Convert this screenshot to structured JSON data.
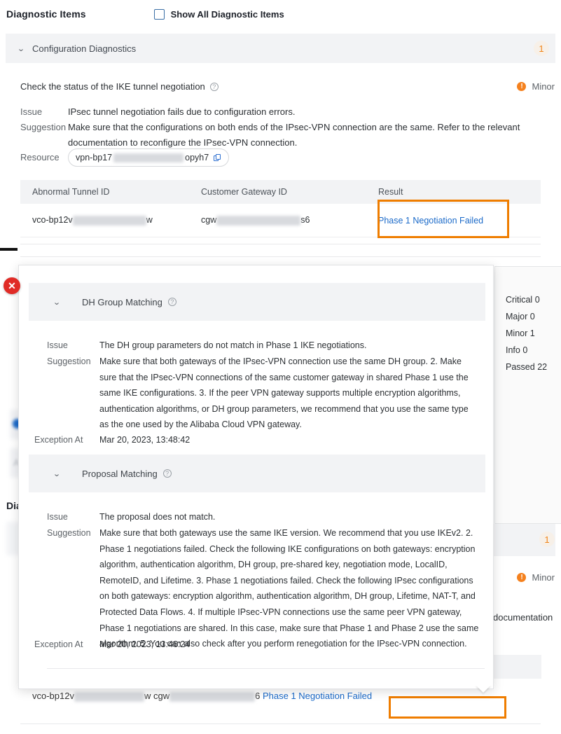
{
  "header": {
    "title": "Diagnostic Items",
    "checkbox_label": "Show All Diagnostic Items",
    "checkbox_checked": false
  },
  "group": {
    "label": "Configuration Diagnostics",
    "count": "1",
    "chevron": "chevron-down-icon"
  },
  "diagnostic": {
    "title": "Check the status of the IKE tunnel negotiation",
    "severity": "Minor",
    "severity_color": "#f5811e",
    "issue_key": "Issue",
    "issue": "IPsec tunnel negotiation fails due to configuration errors.",
    "suggestion_key": "Suggestion",
    "suggestion": "Make sure that the configurations on both ends of the IPsec-VPN connection are the same. Refer to the relevant documentation to reconfigure the IPsec-VPN connection.",
    "resource_key": "Resource",
    "resource_prefix": "vpn-bp17",
    "resource_suffix": "opyh7"
  },
  "table": {
    "columns": [
      "Abnormal Tunnel ID",
      "Customer Gateway ID",
      "Result"
    ],
    "rows": [
      {
        "tunnel_prefix": "vco-bp12v",
        "tunnel_suffix": "w",
        "gateway_prefix": "cgw",
        "gateway_suffix": "s6",
        "result": "Phase 1 Negotiation Failed"
      }
    ],
    "bottom_row": {
      "tunnel_prefix": "vco-bp12v",
      "tunnel_suffix": "w",
      "gateway_prefix": "cgw",
      "gateway_suffix": "6",
      "result": "Phase 1 Negotiation Failed"
    }
  },
  "modal": {
    "close_icon": "close-icon",
    "sections": [
      {
        "label": "DH Group Matching",
        "issue_key": "Issue",
        "issue": "The DH group parameters do not match in Phase 1 IKE negotiations.",
        "suggestion_key": "Suggestion",
        "suggestion": "Make sure that both gateways of the IPsec-VPN connection use the same DH group. 2. Make sure that the IPsec-VPN connections of the same customer gateway in shared Phase 1 use the same IKE configurations. 3. If the peer VPN gateway supports multiple encryption algorithms, authentication algorithms, or DH group parameters, we recommend that you use the same type as the one used by the Alibaba Cloud VPN gateway.",
        "exception_key": "Exception At",
        "exception_at": "Mar 20, 2023, 13:48:42"
      },
      {
        "label": "Proposal Matching",
        "issue_key": "Issue",
        "issue": "The proposal does not match.",
        "suggestion_key": "Suggestion",
        "suggestion": "Make sure that both gateways use the same IKE version. We recommend that you use IKEv2. 2. Phase 1 negotiations failed. Check the following IKE configurations on both gateways: encryption algorithm, authentication algorithm, DH group, pre-shared key, negotiation mode, LocalID, RemoteID, and Lifetime. 3. Phase 1 negotiations failed. Check the following IPsec configurations on both gateways: encryption algorithm, authentication algorithm, DH group, Lifetime, NAT-T, and Protected Data Flows. 4. If multiple IPsec-VPN connections use the same peer VPN gateway, Phase 1 negotiations are shared. In this case, make sure that Phase 1 and Phase 2 use the same algorithm. 5. You can also check after you perform renegotiation for the IPsec-VPN connection.",
        "exception_key": "Exception At",
        "exception_at": "Mar 20, 2023, 13:46:24"
      }
    ]
  },
  "summary": {
    "rows": [
      {
        "label": "Critical",
        "value": "0"
      },
      {
        "label": "Major",
        "value": "0"
      },
      {
        "label": "Minor",
        "value": "1"
      },
      {
        "label": "Info",
        "value": "0"
      },
      {
        "label": "Passed",
        "value": "22"
      }
    ]
  },
  "background": {
    "partial_title": "Dia",
    "partial_letter": "A",
    "partial_count": "1",
    "partial_severity": "Minor",
    "partial_doc_text": "documentation"
  },
  "colors": {
    "accent_orange": "#ef7d00",
    "link_blue": "#1b6ac9",
    "severity_orange": "#f5811e",
    "close_red": "#e02b26"
  }
}
